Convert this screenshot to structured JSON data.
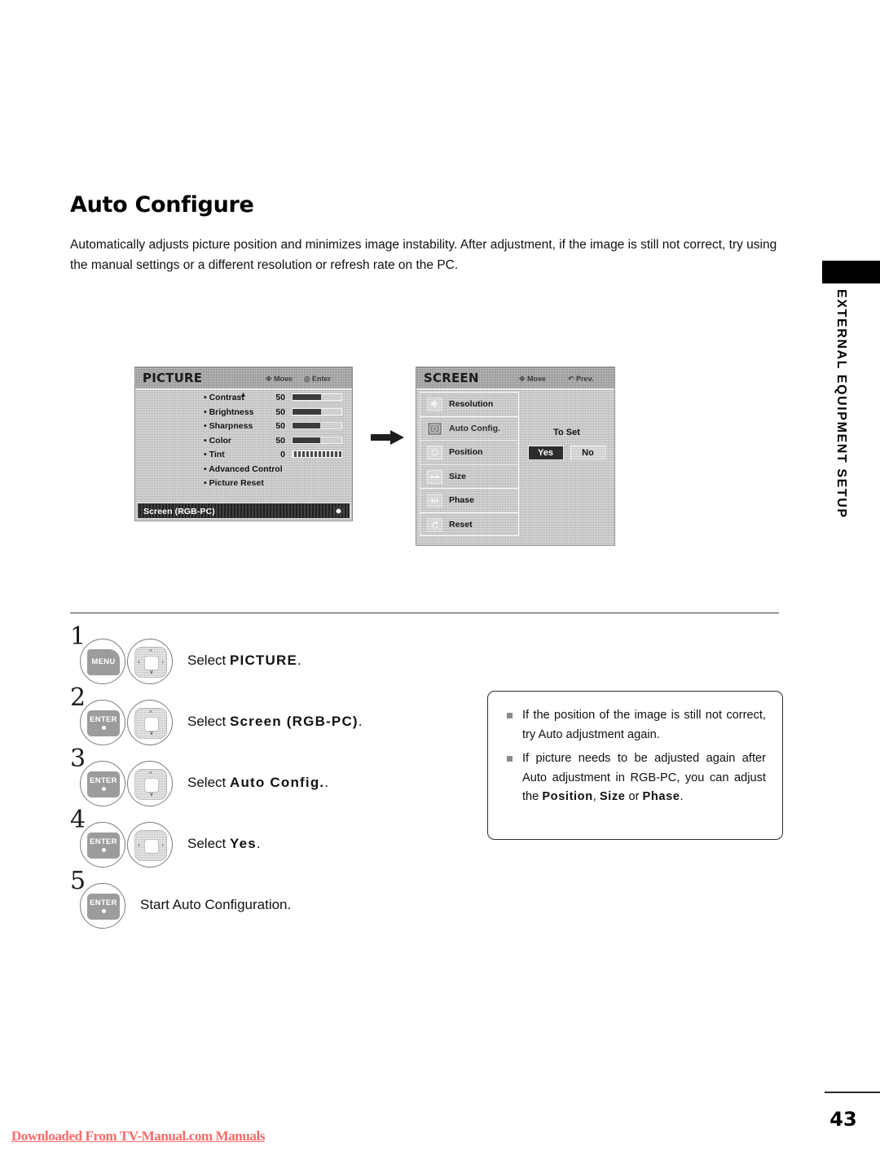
{
  "page": {
    "title": "Auto Configure",
    "intro": "Automatically adjusts picture position and minimizes image instability. After adjustment, if the image is still not correct, try using the manual settings or a different resolution or refresh rate on the PC.",
    "number": "43",
    "download_note": "Downloaded From TV-Manual.com Manuals"
  },
  "side_tab": {
    "label": "EXTERNAL EQUIPMENT SETUP"
  },
  "osd_picture": {
    "title": "PICTURE",
    "hint_move": "Move",
    "hint_enter": "Enter",
    "up_caret": "▲",
    "rows": [
      {
        "label": "• Contrast",
        "value": "50",
        "fill": 58,
        "style": "bar"
      },
      {
        "label": "• Brightness",
        "value": "50",
        "fill": 58,
        "style": "bar"
      },
      {
        "label": "• Sharpness",
        "value": "50",
        "fill": 56,
        "style": "bar"
      },
      {
        "label": "• Color",
        "value": "50",
        "fill": 56,
        "style": "bar"
      },
      {
        "label": "• Tint",
        "value": "0",
        "fill": 100,
        "style": "tint"
      },
      {
        "label": "• Advanced Control",
        "value": "",
        "fill": 0,
        "style": "none"
      },
      {
        "label": "• Picture Reset",
        "value": "",
        "fill": 0,
        "style": "none"
      }
    ],
    "footer_label": "Screen (RGB-PC)"
  },
  "osd_screen": {
    "title": "SCREEN",
    "hint_move": "Move",
    "hint_prev": "Prev.",
    "items": [
      {
        "label": "Resolution",
        "icon": "resolution-icon",
        "selected": false
      },
      {
        "label": "Auto Config.",
        "icon": "auto-config-icon",
        "selected": true
      },
      {
        "label": "Position",
        "icon": "position-icon",
        "selected": false
      },
      {
        "label": "Size",
        "icon": "size-icon",
        "selected": false
      },
      {
        "label": "Phase",
        "icon": "phase-icon",
        "selected": false
      },
      {
        "label": "Reset",
        "icon": "reset-icon",
        "selected": false
      }
    ],
    "to_set_label": "To Set",
    "yes_label": "Yes",
    "no_label": "No"
  },
  "steps": [
    {
      "num": "1",
      "button": "MENU",
      "pad": "lr-ud",
      "text_prefix": "Select ",
      "text_bold": "PICTURE",
      "text_suffix": "."
    },
    {
      "num": "2",
      "button": "ENTER",
      "pad": "ud",
      "text_prefix": "Select ",
      "text_bold": "Screen (RGB-PC)",
      "text_suffix": "."
    },
    {
      "num": "3",
      "button": "ENTER",
      "pad": "ud",
      "text_prefix": "Select ",
      "text_bold": "Auto Config.",
      "text_suffix": "."
    },
    {
      "num": "4",
      "button": "ENTER",
      "pad": "lr",
      "text_prefix": "Select ",
      "text_bold": "Yes",
      "text_suffix": "."
    },
    {
      "num": "5",
      "button": "ENTER",
      "pad": "none",
      "text_prefix": "Start Auto Configuration.",
      "text_bold": "",
      "text_suffix": ""
    }
  ],
  "note": {
    "item1": "If the position of the image is still not correct, try Auto adjustment again.",
    "item2_a": "If picture needs to be adjusted again after Auto adjustment in RGB-PC, you can adjust the ",
    "item2_b": "Position",
    "item2_c": ", ",
    "item2_d": "Size",
    "item2_e": " or ",
    "item2_f": "Phase",
    "item2_g": "."
  },
  "colors": {
    "accent_red": "#fa6a6a",
    "ink": "#111111",
    "osd_gray": "#c9c9c9"
  }
}
